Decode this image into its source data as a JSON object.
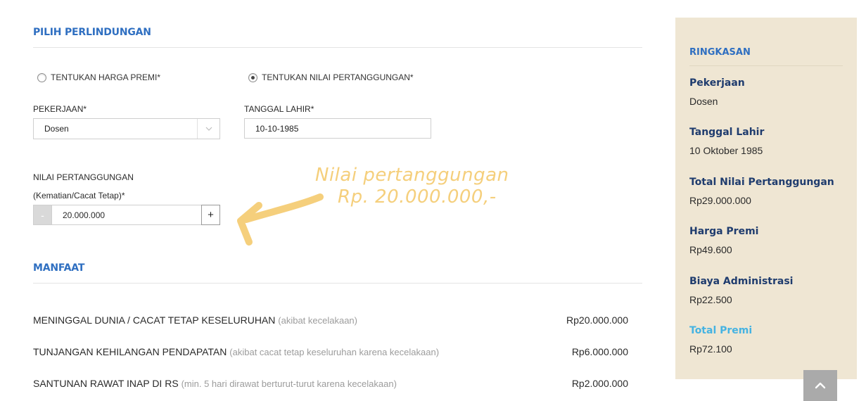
{
  "protection": {
    "title": "PILIH PERLINDUNGAN",
    "radio_premium_label": "TENTUKAN HARGA PREMI*",
    "radio_coverage_label": "TENTUKAN NILAI PERTANGGUNGAN*",
    "selected": "coverage",
    "occupation_label": "PEKERJAAN*",
    "occupation_value": "Dosen",
    "birthdate_label": "TANGGAL LAHIR*",
    "birthdate_value": "10-10-1985",
    "coverage_label_line1": "NILAI PERTANGGUNGAN",
    "coverage_label_line2": "(Kematian/Cacat Tetap)*",
    "coverage_value": "20.000.000",
    "minus_label": "-",
    "plus_label": "+"
  },
  "annotation": {
    "line1": "Nilai pertanggungan",
    "line2": "Rp. 20.000.000,-",
    "color": "#f5cf7c"
  },
  "benefits": {
    "title": "MANFAAT",
    "items": [
      {
        "name": "MENINGGAL DUNIA / CACAT TETAP KESELURUHAN",
        "note": "(akibat kecelakaan)",
        "amount": "Rp20.000.000"
      },
      {
        "name": "TUNJANGAN KEHILANGAN PENDAPATAN",
        "note": "(akibat cacat tetap keseluruhan karena kecelakaan)",
        "amount": "Rp6.000.000"
      },
      {
        "name": "SANTUNAN RAWAT INAP DI RS",
        "note": "(min. 5 hari dirawat berturut-turut karena kecelakaan)",
        "amount": "Rp2.000.000"
      }
    ]
  },
  "summary": {
    "title": "RINGKASAN",
    "items": [
      {
        "key": "Pekerjaan",
        "value": "Dosen"
      },
      {
        "key": "Tanggal Lahir",
        "value": "10 Oktober 1985"
      },
      {
        "key": "Total Nilai Pertanggungan",
        "value": "Rp29.000.000"
      },
      {
        "key": "Harga Premi",
        "value": "Rp49.600"
      },
      {
        "key": "Biaya Administrasi",
        "value": "Rp22.500"
      },
      {
        "key": "Total Premi",
        "value": "Rp72.100"
      }
    ]
  },
  "colors": {
    "heading_blue": "#2f6fc1",
    "summary_bg": "#efe6d3",
    "summary_key": "#1f3c6e",
    "total_accent": "#45b3e2"
  },
  "icons": {
    "back_to_top": "chevron-up-icon",
    "select_arrow": "chevron-down-icon",
    "annotation_arrow": "hand-drawn-arrow-icon"
  }
}
